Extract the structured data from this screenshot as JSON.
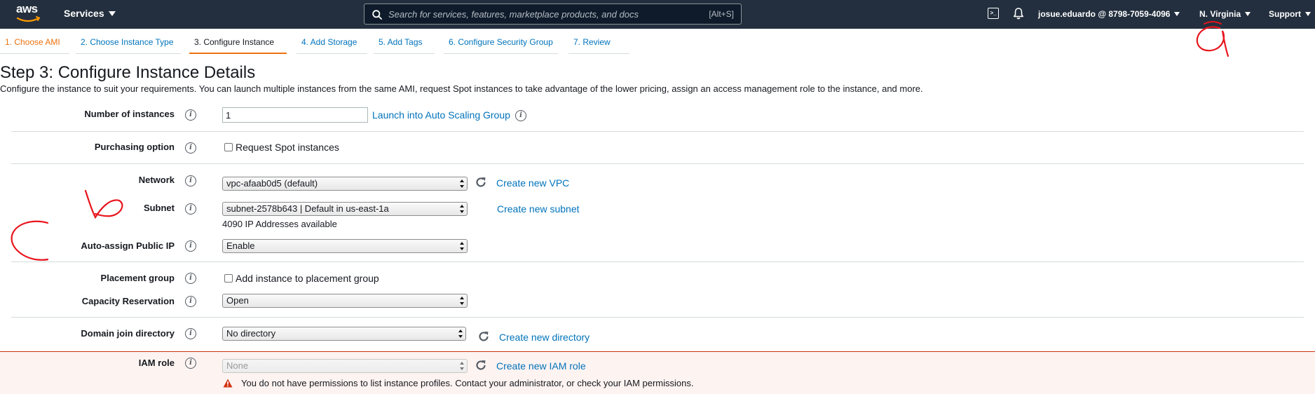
{
  "topnav": {
    "logo_text": "aws",
    "services_label": "Services",
    "search_placeholder": "Search for services, features, marketplace products, and docs",
    "search_shortcut": "[Alt+S]",
    "cloudshell_glyph": ">_",
    "account_label": "josue.eduardo @ 8798-7059-4096",
    "region_label": "N. Virginia",
    "support_label": "Support"
  },
  "steps": [
    {
      "label": "1. Choose AMI",
      "state": "done"
    },
    {
      "label": "2. Choose Instance Type",
      "state": "link"
    },
    {
      "label": "3. Configure Instance",
      "state": "active"
    },
    {
      "label": "4. Add Storage",
      "state": "link"
    },
    {
      "label": "5. Add Tags",
      "state": "link"
    },
    {
      "label": "6. Configure Security Group",
      "state": "link"
    },
    {
      "label": "7. Review",
      "state": "link"
    }
  ],
  "page": {
    "title": "Step 3: Configure Instance Details",
    "description": "Configure the instance to suit your requirements. You can launch multiple instances from the same AMI, request Spot instances to take advantage of the lower pricing, assign an access management role to the instance, and more."
  },
  "form": {
    "number_of_instances": {
      "label": "Number of instances",
      "value": "1",
      "link": "Launch into Auto Scaling Group"
    },
    "purchasing_option": {
      "label": "Purchasing option",
      "checkbox_label": "Request Spot instances",
      "checked": false
    },
    "network": {
      "label": "Network",
      "value": "vpc-afaab0d5 (default)",
      "link": "Create new VPC"
    },
    "subnet": {
      "label": "Subnet",
      "value": "subnet-2578b643 | Default in us-east-1a",
      "link": "Create new subnet",
      "available": "4090 IP Addresses available"
    },
    "auto_assign_public_ip": {
      "label": "Auto-assign Public IP",
      "value": "Enable"
    },
    "placement_group": {
      "label": "Placement group",
      "checkbox_label": "Add instance to placement group",
      "checked": false
    },
    "capacity_reservation": {
      "label": "Capacity Reservation",
      "value": "Open"
    },
    "domain_join_directory": {
      "label": "Domain join directory",
      "value": "No directory",
      "link": "Create new directory"
    },
    "iam_role": {
      "label": "IAM role",
      "value": "None",
      "link": "Create new IAM role",
      "error": "You do not have permissions to list instance profiles. Contact your administrator, or check your IAM permissions."
    }
  },
  "colors": {
    "nav_bg": "#232f3e",
    "link": "#0073bb",
    "accent": "#ec7211",
    "error": "#d13212",
    "annotation": "#e8141c"
  }
}
